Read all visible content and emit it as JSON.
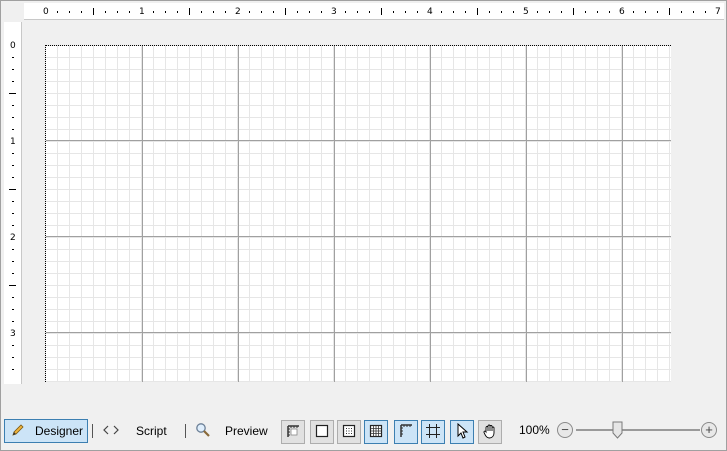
{
  "ruler": {
    "horizontal_numbers": [
      "0",
      "1",
      "2",
      "3",
      "4",
      "5",
      "6",
      "7"
    ],
    "vertical_numbers": [
      "0",
      "1",
      "2",
      "3"
    ]
  },
  "tabs": {
    "designer": {
      "label": "Designer",
      "icon": "pencil-icon",
      "active": true
    },
    "script": {
      "label": "Script",
      "icon": "code-brackets-icon"
    },
    "preview": {
      "label": "Preview",
      "icon": "magnifier-icon"
    }
  },
  "toolbar": {
    "buttons": [
      {
        "name": "page-setup-button",
        "icon": "ruler-corner-icon",
        "checked": false
      },
      {
        "name": "grid-none-button",
        "icon": "square-icon",
        "checked": false
      },
      {
        "name": "grid-dots-button",
        "icon": "dotted-grid-icon",
        "checked": false
      },
      {
        "name": "grid-lines-button",
        "icon": "grid-icon",
        "checked": true
      },
      {
        "name": "rulers-button",
        "icon": "rulers-icon",
        "checked": true
      },
      {
        "name": "snap-to-grid-button",
        "icon": "snap-icon",
        "checked": true
      },
      {
        "name": "select-tool-button",
        "icon": "cursor-arrow-icon",
        "checked": true
      },
      {
        "name": "pan-tool-button",
        "icon": "hand-icon",
        "checked": false
      }
    ]
  },
  "zoom": {
    "label": "100%",
    "minus": "−",
    "plus": "+",
    "level_percent": 100
  },
  "colors": {
    "accent_fill": "#cce4f7",
    "accent_border": "#3c7fb1",
    "grid_major": "#a0a0a0",
    "grid_minor": "#e6e6e6"
  }
}
